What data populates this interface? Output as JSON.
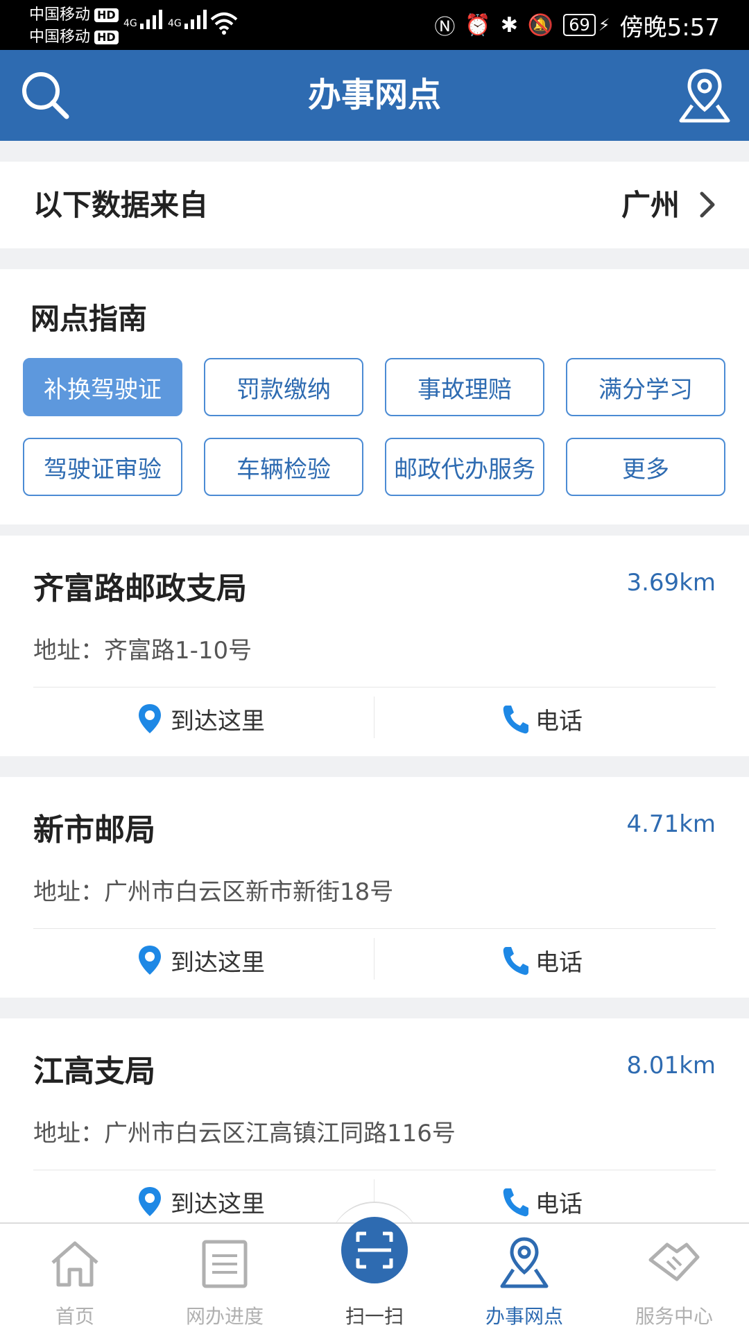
{
  "status": {
    "carrier1": "中国移动",
    "carrier2": "中国移动",
    "hd": "HD",
    "net": "4G",
    "battery": "69",
    "time": "傍晚5:57"
  },
  "header": {
    "title": "办事网点"
  },
  "source": {
    "label": "以下数据来自",
    "city": "广州"
  },
  "guide": {
    "title": "网点指南",
    "tags": [
      "补换驾驶证",
      "罚款缴纳",
      "事故理赔",
      "满分学习",
      "驾驶证审验",
      "车辆检验",
      "邮政代办服务",
      "更多"
    ],
    "active_index": 0
  },
  "offices": [
    {
      "name": "齐富路邮政支局",
      "distance": "3.69km",
      "address": "地址：齐富路1-10号",
      "navigate": "到达这里",
      "phone": "电话"
    },
    {
      "name": "新市邮局",
      "distance": "4.71km",
      "address": "地址：广州市白云区新市新街18号",
      "navigate": "到达这里",
      "phone": "电话"
    },
    {
      "name": "江高支局",
      "distance": "8.01km",
      "address": "地址：广州市白云区江高镇江同路116号",
      "navigate": "到达这里",
      "phone": "电话"
    }
  ],
  "tabs": [
    "首页",
    "网办进度",
    "扫一扫",
    "办事网点",
    "服务中心"
  ],
  "icons": {
    "search": "search-icon",
    "location": "map-location-icon",
    "chevron": "chevron-right-icon",
    "pin": "location-pin-icon",
    "phone": "phone-icon",
    "home": "home-icon",
    "progress": "progress-icon",
    "scan": "scan-icon",
    "service": "handshake-icon"
  },
  "colors": {
    "primary": "#2e6bb1",
    "active_tag": "#5d98dd",
    "inactive_tab": "#b0b0b0"
  }
}
